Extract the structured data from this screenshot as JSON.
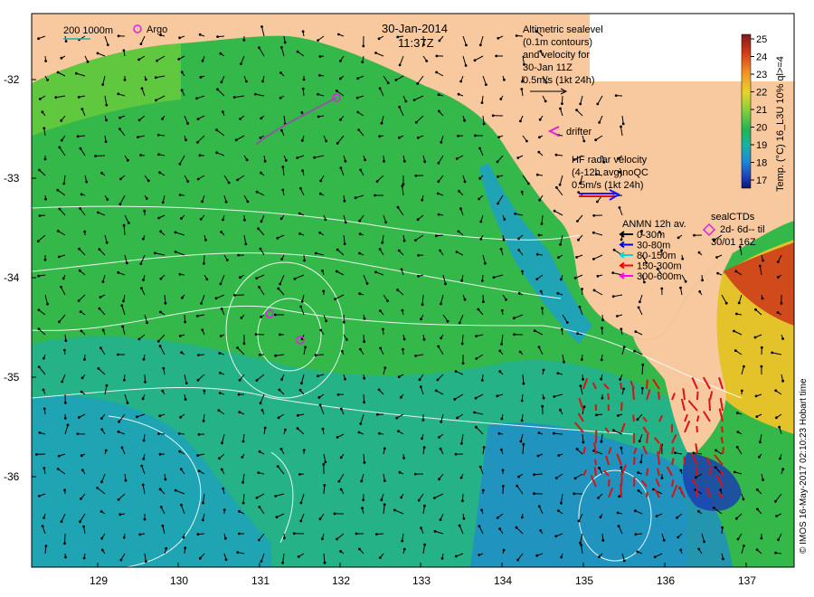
{
  "map": {
    "date": "30-Jan-2014",
    "time": "11:37Z",
    "scale_bar_label": "200  1000m",
    "argo_label": "Argo",
    "drifter_label": "drifter",
    "altimetric_lines": [
      "Altimetric sealevel",
      "(0.1m contours)",
      "and velocity for",
      "30-Jan 11Z",
      "0.5m/s (1kt 24h)"
    ],
    "hf_radar_lines": [
      "HF radar velocity",
      "(4-12h avg)noQC",
      "0.5m/s (1kt 24h)"
    ],
    "anmn_title": "ANMN 12h av.",
    "anmn_rows": [
      {
        "label": "0-30m",
        "color": "#000000"
      },
      {
        "label": "30-80m",
        "color": "#0000ff"
      },
      {
        "label": "80-150m",
        "color": "#00d8d8"
      },
      {
        "label": "150-300m",
        "color": "#ff0000"
      },
      {
        "label": "300-600m",
        "color": "#ff00ff"
      }
    ],
    "sealctd_lines": [
      "sealCTDs",
      "2d- 6d-- til",
      "30/01 16Z"
    ],
    "colorbar_title": "Temp. (°C) 16_L3U 10% ql>=4",
    "credit": "© IMOS 16-May-2017 02:10:23 Hobart time",
    "colorbar_ticks": [
      "25",
      "24",
      "23",
      "22",
      "21",
      "20",
      "19",
      "18",
      "17"
    ],
    "y_ticks": [
      "-32",
      "-33",
      "-34",
      "-35",
      "-36"
    ],
    "x_ticks": [
      "129",
      "130",
      "131",
      "132",
      "133",
      "134",
      "135",
      "136",
      "137"
    ],
    "colors": {
      "land": "#f8c89e",
      "water_main": "#35b84a",
      "accent_magenta": "#e020e0",
      "hf_red": "#dd1111"
    }
  }
}
